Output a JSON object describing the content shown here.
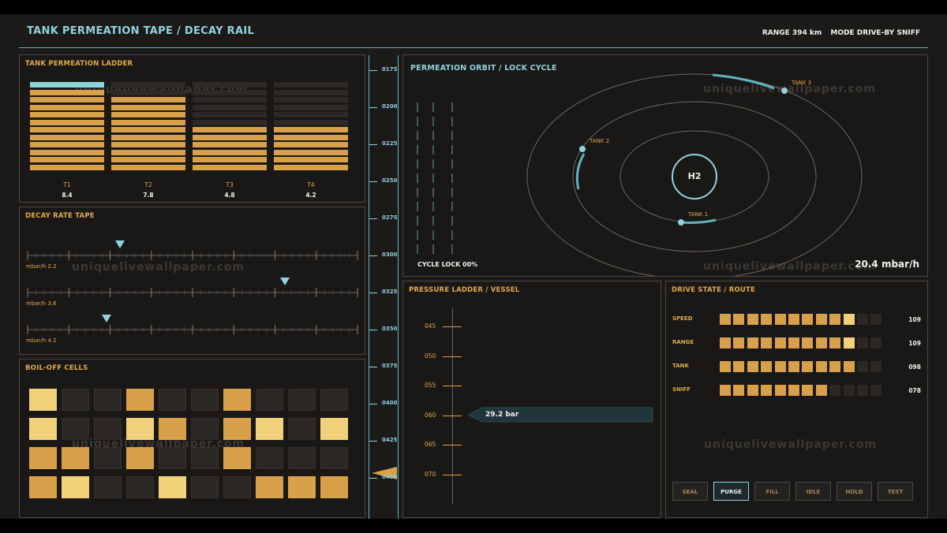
{
  "header": {
    "title": "TANK PERMEATION TAPE / DECAY RAIL",
    "range": "RANGE 394 km",
    "mode": "MODE DRIVE-BY SNIFF"
  },
  "watermark": "uniquelivewallpaper.com",
  "ladder": {
    "title": "TANK PERMEATION LADDER",
    "segments": 12,
    "tanks": [
      {
        "label": "T1",
        "value": "8.4",
        "lit": 11,
        "cyan_top": true
      },
      {
        "label": "T2",
        "value": "7.8",
        "lit": 10,
        "cyan_top": false
      },
      {
        "label": "T3",
        "value": "4.8",
        "lit": 6,
        "cyan_top": false
      },
      {
        "label": "T4",
        "value": "4.2",
        "lit": 6,
        "cyan_top": false
      }
    ]
  },
  "decay": {
    "title": "DECAY RATE TAPE",
    "tapes": [
      {
        "label": "mbar/h 2.2",
        "marker": 0.28
      },
      {
        "label": "mbar/h 3.6",
        "marker": 0.78
      },
      {
        "label": "mbar/h 4.2",
        "marker": 0.24
      }
    ]
  },
  "boiloff": {
    "title": "BOIL-OFF CELLS",
    "grid": [
      [
        "y",
        "d",
        "d",
        "o",
        "d",
        "d",
        "o",
        "d",
        "d",
        "d"
      ],
      [
        "y",
        "d",
        "d",
        "y",
        "o",
        "d",
        "o",
        "y",
        "d",
        "y"
      ],
      [
        "o",
        "o",
        "d",
        "o",
        "d",
        "d",
        "o",
        "d",
        "d",
        "d"
      ],
      [
        "o",
        "y",
        "d",
        "d",
        "y",
        "d",
        "d",
        "o",
        "o",
        "o"
      ]
    ]
  },
  "rail": {
    "ticks": [
      "0175",
      "0200",
      "0225",
      "0250",
      "0275",
      "0300",
      "0325",
      "0350",
      "0375",
      "0400",
      "0425",
      "0450"
    ],
    "marker_value": 447
  },
  "orbit": {
    "title": "PERMEATION ORBIT / LOCK CYCLE",
    "core": "H2",
    "tank3": "TANK 3",
    "tank2": "TANK 2",
    "tank1": "TANK 1",
    "cycle_lock": "CYCLE LOCK 00%",
    "rate": "20.4 mbar/h"
  },
  "pressure": {
    "title": "PRESSURE LADDER / VESSEL",
    "ticks": [
      "045",
      "050",
      "055",
      "060",
      "065",
      "070"
    ],
    "readout": "29.2 bar"
  },
  "drive": {
    "title": "DRIVE STATE / ROUTE",
    "rows": [
      {
        "label": "SPEED",
        "value": "109",
        "lit": 10,
        "hi": 10
      },
      {
        "label": "RANGE",
        "value": "109",
        "lit": 10,
        "hi": 10
      },
      {
        "label": "TANK",
        "value": "098",
        "lit": 10,
        "hi": 0
      },
      {
        "label": "SNIFF",
        "value": "078",
        "lit": 8,
        "hi": 0
      }
    ],
    "buttons": [
      "SEAL",
      "PURGE",
      "FILL",
      "IDLE",
      "HOLD",
      "TEST"
    ],
    "active_button": "PURGE"
  },
  "colors": {
    "accent": "#8fd3dc",
    "amber": "#d8a048",
    "yellow": "#f1d27a"
  }
}
